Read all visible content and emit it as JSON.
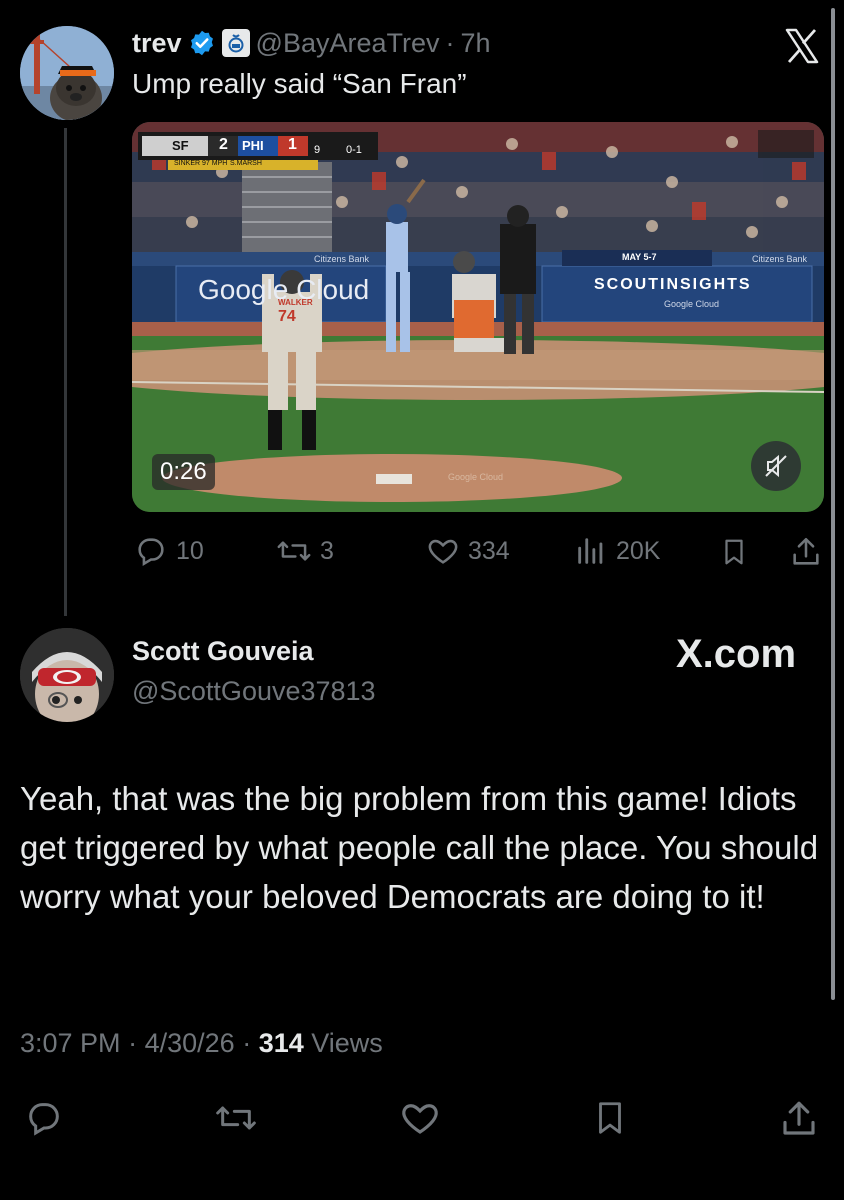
{
  "original_tweet": {
    "display_name": "trev",
    "handle": "@BayAreaTrev",
    "separator": "·",
    "time": "7h",
    "text": "Ump really said “San Fran”",
    "video": {
      "duration": "0:26",
      "scorebug": {
        "away_team": "SF",
        "away_score": "2",
        "home_team": "PHI",
        "home_score": "1",
        "inning": "9",
        "count": "0-1",
        "pitch": "SINKER 97 MPH",
        "batter": "S.MARSH"
      },
      "signage": {
        "board_left": "Google Cloud",
        "board_right": "SCOUTINSIGHTS",
        "board_right_sub": "Google Cloud",
        "promo_date": "MAY 5-7",
        "ribbon_left": "Citizens Bank",
        "ribbon_right": "Citizens Bank",
        "pitcher_name": "WALKER",
        "pitcher_number": "74",
        "mound_text": "Google Cloud"
      }
    },
    "actions": {
      "replies": "10",
      "reposts": "3",
      "likes": "334",
      "views": "20K"
    }
  },
  "reply_tweet": {
    "display_name": "Scott Gouveia",
    "handle": "@ScottGouve37813",
    "watermark": "X.com",
    "text": "Yeah, that was the big problem from this game! Idiots get triggered by what people call the place. You should worry what your beloved Democrats are doing to it!",
    "time": "3:07 PM",
    "date": "4/30/26",
    "views_count": "314",
    "views_label": "Views"
  },
  "colors": {
    "background": "#000000",
    "text_primary": "#e7e9ea",
    "text_secondary": "#71767b",
    "verified_badge": "#1d9bf0",
    "divider": "#333639"
  },
  "icons": [
    "x-logo-icon",
    "verified-badge-icon",
    "automated-account-icon",
    "reply-icon",
    "repost-icon",
    "like-icon",
    "views-icon",
    "bookmark-icon",
    "share-icon",
    "mute-icon"
  ]
}
